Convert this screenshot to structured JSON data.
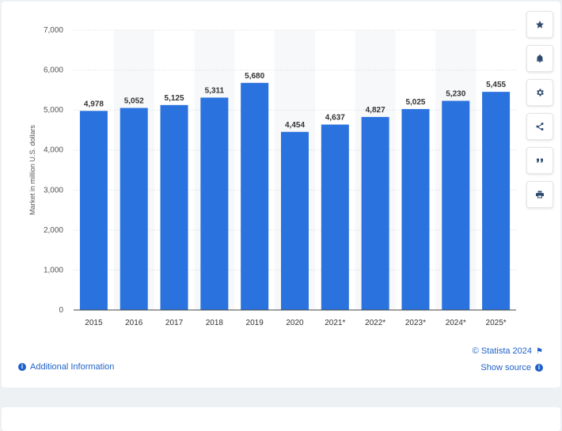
{
  "chart_data": {
    "type": "bar",
    "categories": [
      "2015",
      "2016",
      "2017",
      "2018",
      "2019",
      "2020",
      "2021*",
      "2022*",
      "2023*",
      "2024*",
      "2025*"
    ],
    "values": [
      4978,
      5052,
      5125,
      5311,
      5680,
      4454,
      4637,
      4827,
      5025,
      5230,
      5455
    ],
    "value_labels": [
      "4,978",
      "5,052",
      "5,125",
      "5,311",
      "5,680",
      "4,454",
      "4,637",
      "4,827",
      "5,025",
      "5,230",
      "5,455"
    ],
    "ylabel": "Market in million U.S. dollars",
    "xlabel": "",
    "ylim": [
      0,
      7000
    ],
    "yticks": [
      0,
      1000,
      2000,
      3000,
      4000,
      5000,
      6000,
      7000
    ],
    "ytick_labels": [
      "0",
      "1,000",
      "2,000",
      "3,000",
      "4,000",
      "5,000",
      "6,000",
      "7,000"
    ],
    "grid": true,
    "legend": "none",
    "bar_color": "#2a72de"
  },
  "footer": {
    "additional_info": "Additional Information",
    "copyright": "© Statista 2024",
    "show_source": "Show source"
  },
  "toolbar": {
    "icons": [
      "star-icon",
      "bell-icon",
      "gear-icon",
      "share-icon",
      "quote-icon",
      "print-icon"
    ]
  }
}
